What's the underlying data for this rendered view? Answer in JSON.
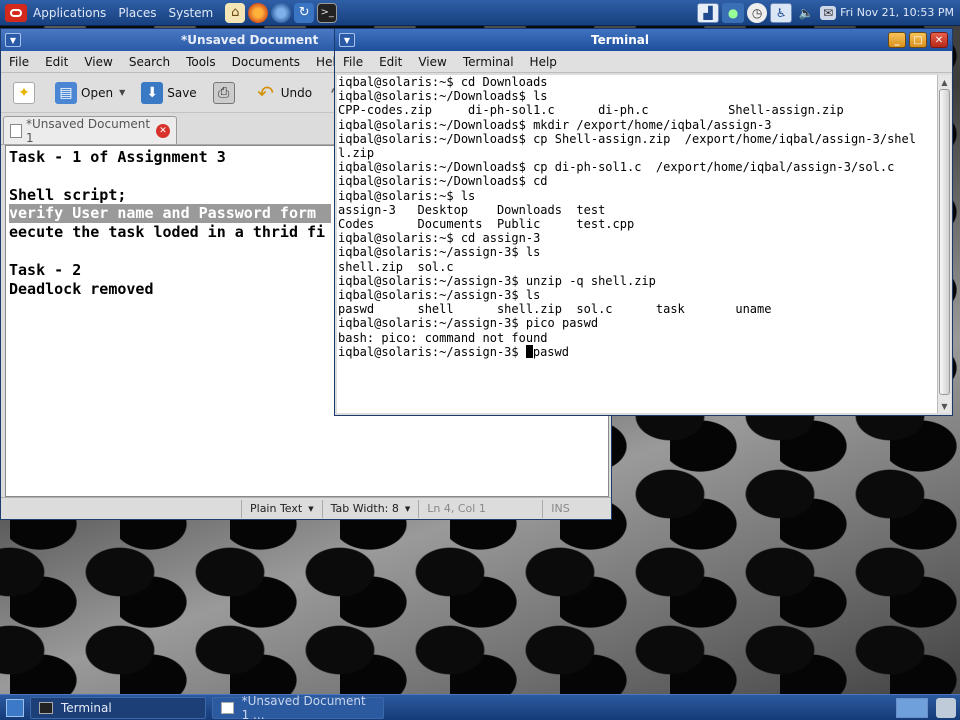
{
  "top_panel": {
    "menus": [
      "Applications",
      "Places",
      "System"
    ],
    "launchers": [
      "home-icon",
      "firefox-icon",
      "thunderbird-icon",
      "update-icon",
      "terminal-icon"
    ],
    "tray_icons": [
      "system-monitor-icon",
      "network-icon",
      "clock-icon",
      "accessibility-icon",
      "volume-icon",
      "mail-icon"
    ],
    "clock": "Fri Nov 21, 10:53 PM"
  },
  "gedit": {
    "title": "*Unsaved Document",
    "menu": [
      "File",
      "Edit",
      "View",
      "Search",
      "Tools",
      "Documents",
      "Help"
    ],
    "toolbar": {
      "open_label": "Open",
      "save_label": "Save",
      "undo_label": "Undo"
    },
    "tab_label": "*Unsaved Document 1",
    "lines": [
      "Task - 1 of Assignment 3",
      "",
      "Shell script;",
      "verify User name and Password form",
      "eecute the task loded in a thrid fi",
      "",
      "Task - 2",
      "Deadlock removed"
    ],
    "selected_line_index": 3,
    "status": {
      "language": "Plain Text",
      "tab_width": "Tab Width:  8",
      "position": "Ln 4, Col 1",
      "mode": "INS"
    }
  },
  "terminal": {
    "title": "Terminal",
    "menu": [
      "File",
      "Edit",
      "View",
      "Terminal",
      "Help"
    ],
    "lines": [
      "iqbal@solaris:~$ cd Downloads",
      "iqbal@solaris:~/Downloads$ ls",
      "CPP-codes.zip     di-ph-sol1.c      di-ph.c           Shell-assign.zip",
      "iqbal@solaris:~/Downloads$ mkdir /export/home/iqbal/assign-3",
      "iqbal@solaris:~/Downloads$ cp Shell-assign.zip  /export/home/iqbal/assign-3/shel",
      "l.zip",
      "iqbal@solaris:~/Downloads$ cp di-ph-sol1.c  /export/home/iqbal/assign-3/sol.c",
      "iqbal@solaris:~/Downloads$ cd",
      "iqbal@solaris:~$ ls",
      "assign-3   Desktop    Downloads  test",
      "Codes      Documents  Public     test.cpp",
      "iqbal@solaris:~$ cd assign-3",
      "iqbal@solaris:~/assign-3$ ls",
      "shell.zip  sol.c",
      "iqbal@solaris:~/assign-3$ unzip -q shell.zip",
      "iqbal@solaris:~/assign-3$ ls",
      "paswd      shell      shell.zip  sol.c      task       uname",
      "iqbal@solaris:~/assign-3$ pico paswd",
      "bash: pico: command not found"
    ],
    "prompt": "iqbal@solaris:~/assign-3$ ",
    "current_input": "paswd"
  },
  "bottom_panel": {
    "tasks": [
      "Terminal",
      "*Unsaved Document 1 ..."
    ]
  }
}
